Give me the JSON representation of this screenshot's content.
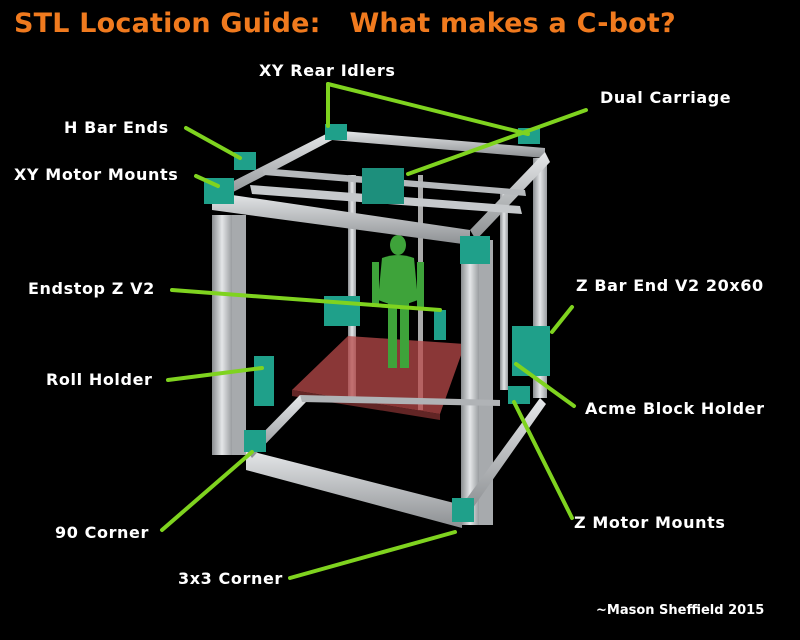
{
  "title": "STL Location Guide:   What makes a C-bot?",
  "labels": {
    "xy_rear_idlers": "XY Rear Idlers",
    "dual_carriage": "Dual Carriage",
    "h_bar_ends": "H Bar Ends",
    "xy_motor_mounts": "XY Motor Mounts",
    "endstop_z_v2": "Endstop Z V2",
    "z_bar_end_v2": "Z Bar End V2 20x60",
    "roll_holder": "Roll Holder",
    "acme_block_holder": "Acme Block Holder",
    "corner_90": "90 Corner",
    "z_motor_mounts": "Z Motor Mounts",
    "corner_3x3": "3x3 Corner"
  },
  "credit": "~Mason Sheffield 2015",
  "colors": {
    "title": "#f07a1e",
    "leader": "#7fd31f",
    "extrusion": "#cfd2d4",
    "printed_part": "#1fa08a",
    "bed": "#b84a4a",
    "figure": "#3ea33a"
  },
  "icons": {
    "printer": "c-bot-3d-printer-frame",
    "figure": "green-human-figure"
  }
}
